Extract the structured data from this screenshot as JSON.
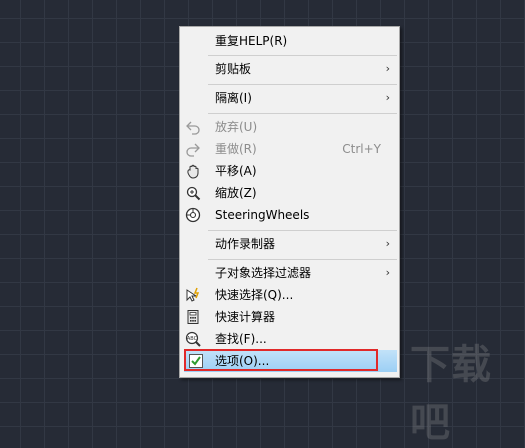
{
  "context_menu": {
    "items": [
      {
        "label": "重复HELP(R)"
      },
      {
        "label": "剪贴板",
        "arrow": "›"
      },
      {
        "label": "隔离(I)",
        "arrow": "›"
      },
      {
        "label": "放弃(U)",
        "icon": "undo-icon",
        "disabled": true
      },
      {
        "label": "重做(R)",
        "shortcut": "Ctrl+Y",
        "icon": "redo-icon",
        "disabled": true
      },
      {
        "label": "平移(A)",
        "icon": "pan-hand-icon"
      },
      {
        "label": "缩放(Z)",
        "icon": "zoom-icon"
      },
      {
        "label": "SteeringWheels",
        "icon": "steering-wheel-icon"
      },
      {
        "label": "动作录制器",
        "arrow": "›"
      },
      {
        "label": "子对象选择过滤器",
        "arrow": "›"
      },
      {
        "label": "快速选择(Q)...",
        "icon": "quick-select-icon"
      },
      {
        "label": "快速计算器",
        "icon": "calculator-icon"
      },
      {
        "label": "查找(F)...",
        "icon": "find-abc-icon"
      },
      {
        "label": "选项(O)...",
        "icon": "options-check-icon",
        "highlighted": true
      }
    ]
  },
  "watermark": {
    "text": "下载吧"
  },
  "colors": {
    "canvas_bg": "#262b36",
    "grid_line": "#323844",
    "menu_bg": "#f1f1f1",
    "highlight": "#9ccff4",
    "annotation_box": "#e12929"
  }
}
